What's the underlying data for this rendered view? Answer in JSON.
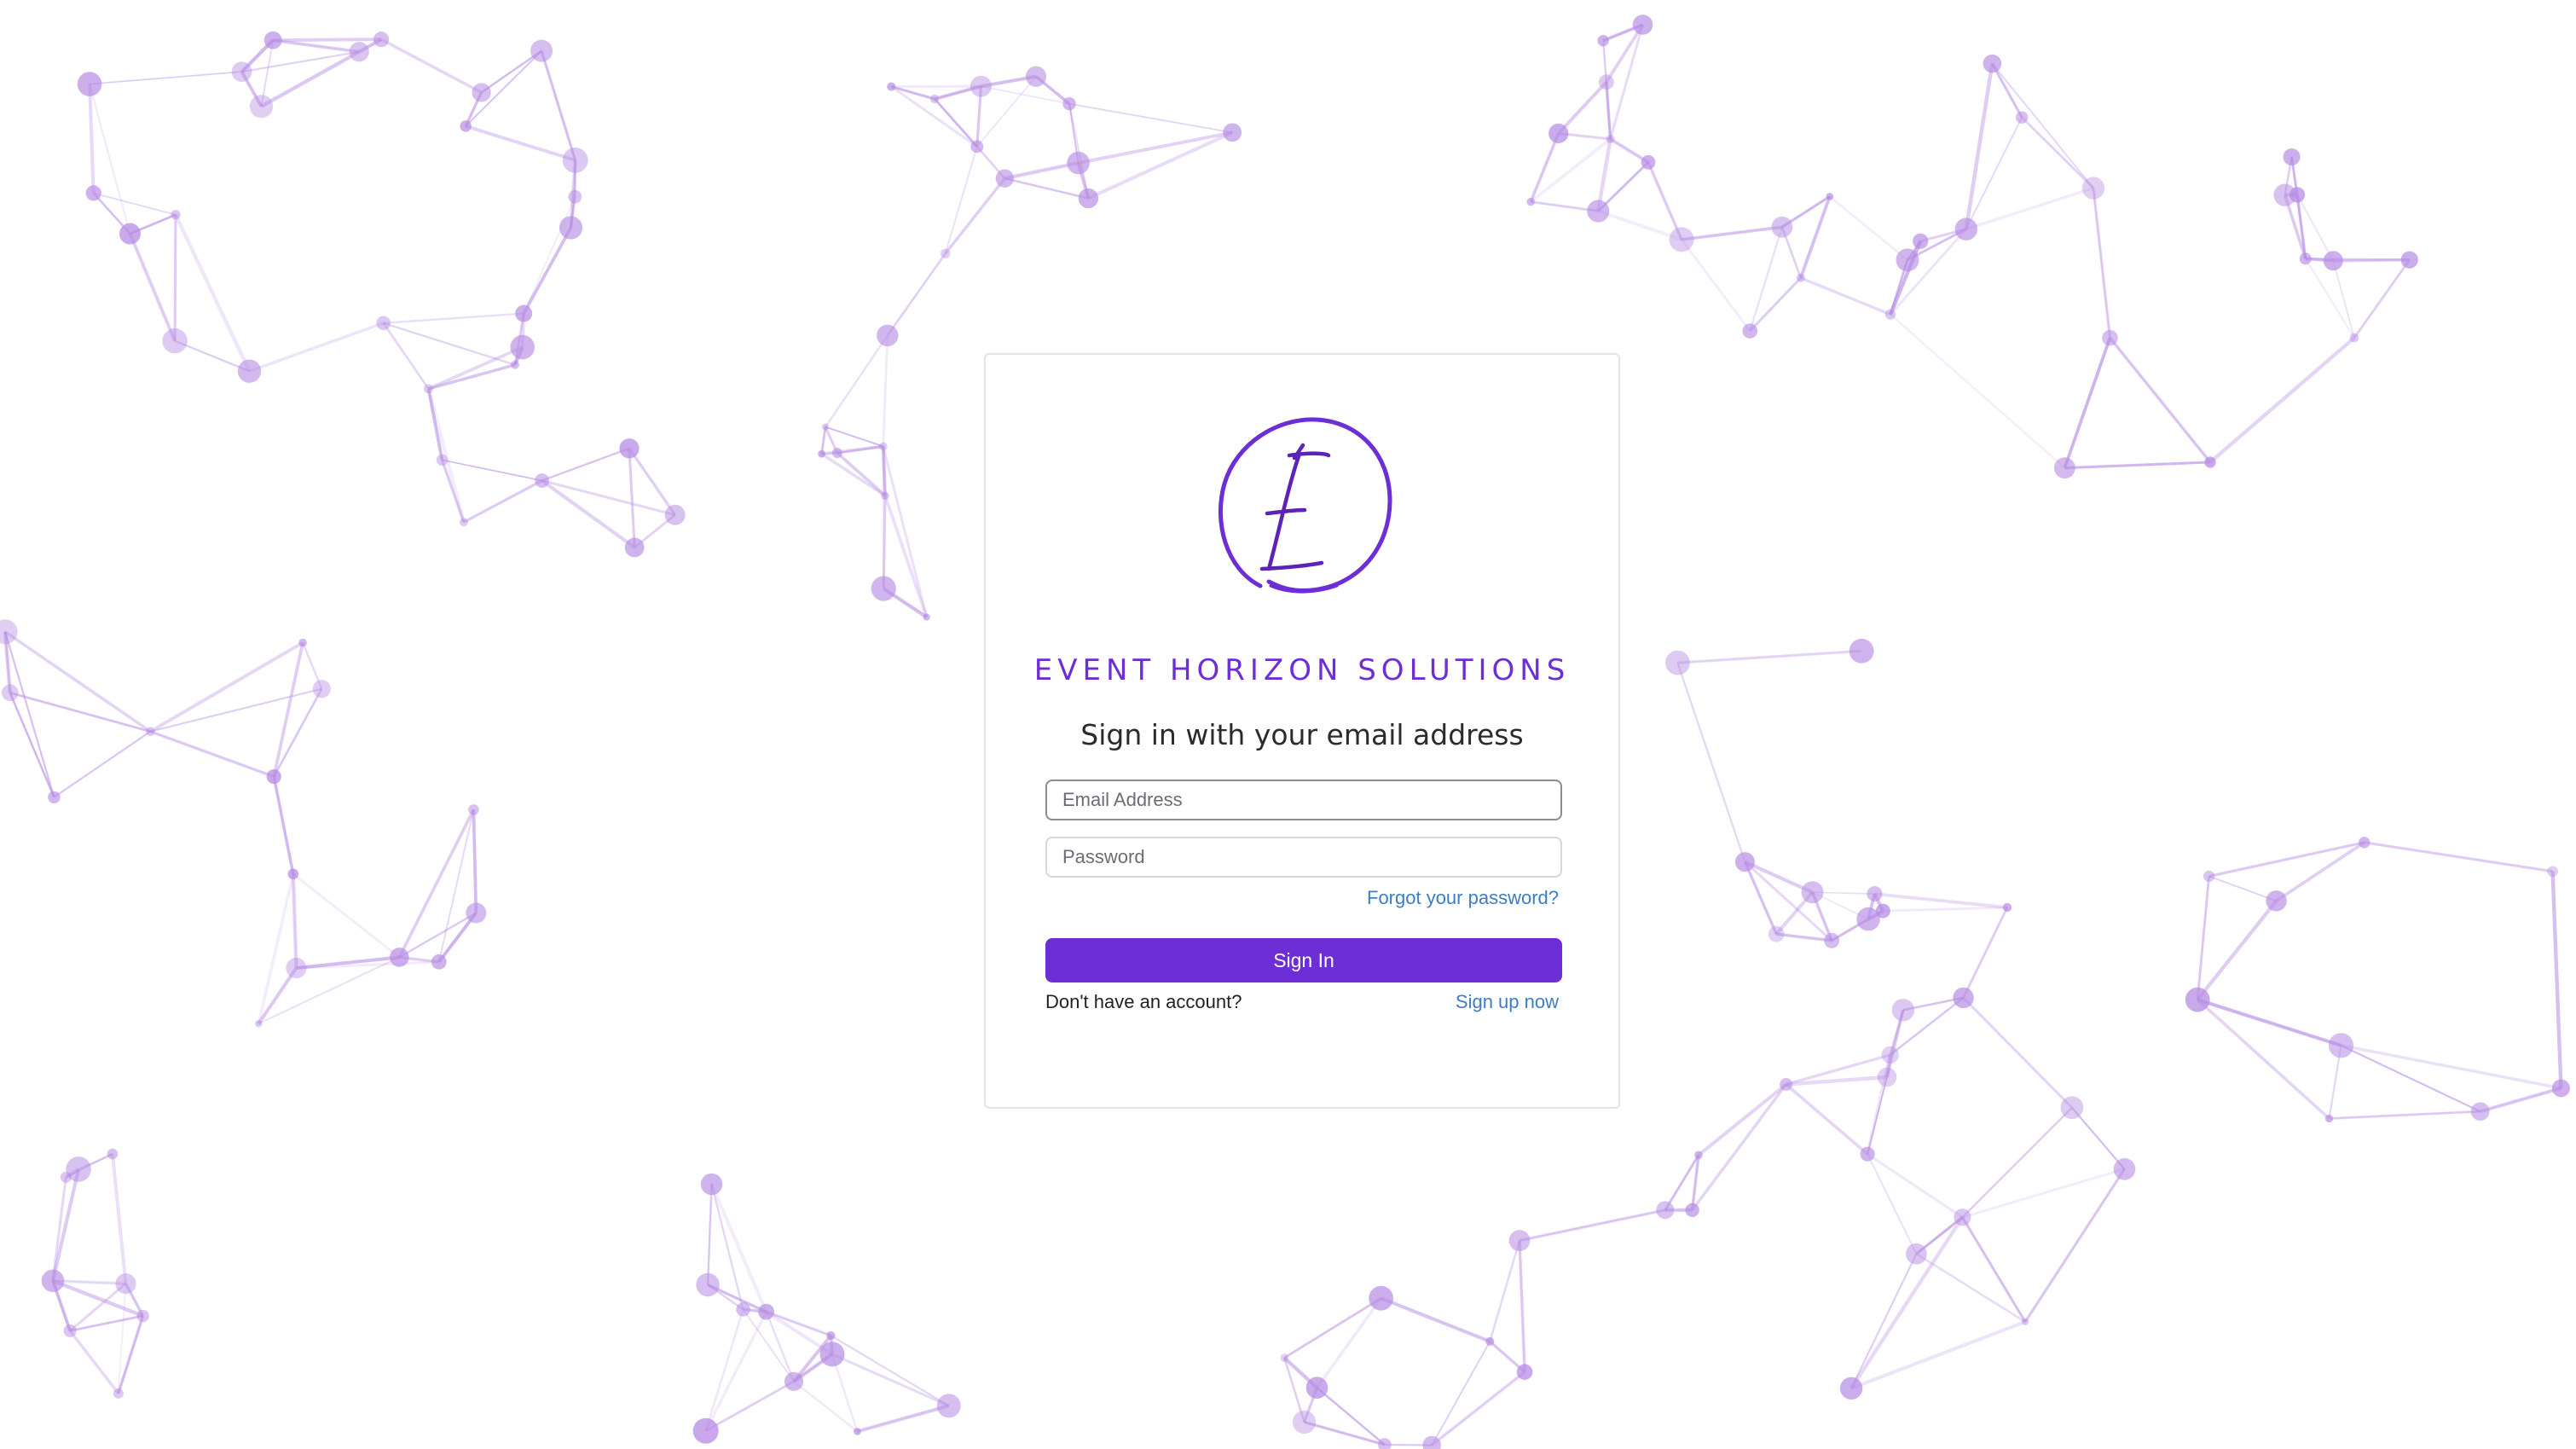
{
  "brand": {
    "name": "EVENT HORIZON SOLUTIONS",
    "logo_letter": "E",
    "accent_color": "#6d2ed6"
  },
  "form": {
    "heading": "Sign in with your email address",
    "email_placeholder": "Email Address",
    "password_placeholder": "Password",
    "forgot_link": "Forgot your password?",
    "submit_label": "Sign In",
    "no_account_text": "Don't have an account?",
    "signup_link": "Sign up now"
  },
  "colors": {
    "link": "#3b7ec4",
    "network": "#b58be3"
  }
}
